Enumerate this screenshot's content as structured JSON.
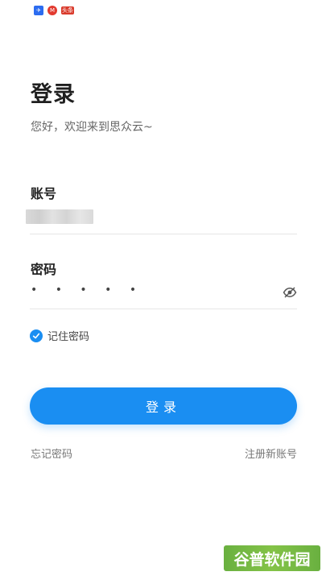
{
  "status_bar": {
    "icons": [
      "paper-plane-icon",
      "mall-icon",
      "news-app-icon"
    ],
    "icon_labels": [
      "✈",
      "M",
      "头条"
    ]
  },
  "header": {
    "title": "登录",
    "subtitle": "您好，欢迎来到思众云~"
  },
  "form": {
    "account_label": "账号",
    "account_value_obscured": true,
    "password_label": "密码",
    "password_value": "• • • • •",
    "password_visibility_icon": "eye-off-icon",
    "remember_label": "记住密码",
    "remember_checked": true,
    "login_button_label": "登录"
  },
  "links": {
    "forgot": "忘记密码",
    "register": "注册新账号"
  },
  "watermark": {
    "text": "谷普软件园"
  },
  "colors": {
    "accent": "#1a8ef2",
    "watermark_bg": "#77bd34"
  }
}
